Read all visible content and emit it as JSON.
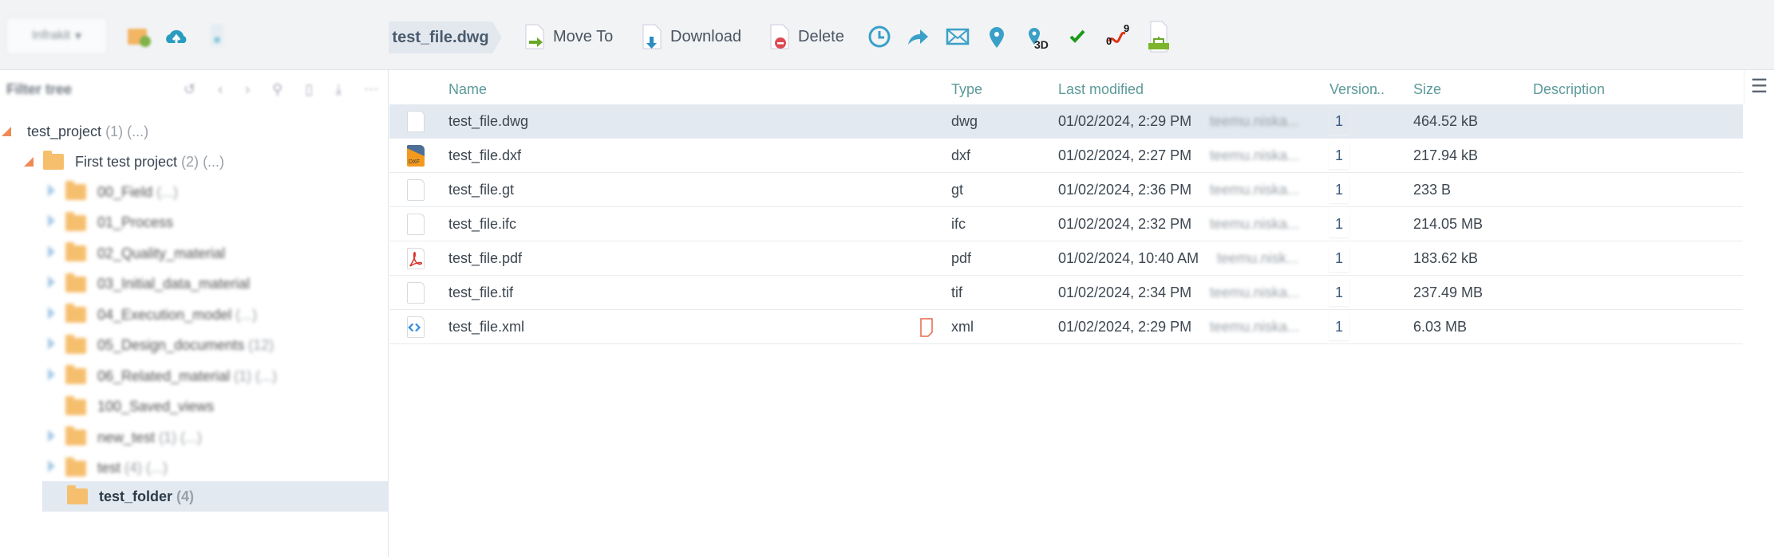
{
  "topbar": {
    "org": "Infrakit",
    "breadcrumb": "test_file.dwg",
    "move_to": "Move To",
    "download": "Download",
    "delete": "Delete",
    "badge_3d": "3D",
    "seq_from": "0",
    "seq_to": "9"
  },
  "sidebar": {
    "filter": "Filter tree",
    "root": {
      "label": "test_project",
      "count": "(1)",
      "more": "(...)"
    },
    "project": {
      "label": "First test project",
      "count": "(2)",
      "more": "(...)"
    },
    "folders": [
      {
        "label": "00_Field",
        "count": "(...)"
      },
      {
        "label": "01_Process",
        "count": ""
      },
      {
        "label": "02_Quality_material",
        "count": ""
      },
      {
        "label": "03_Initial_data_material",
        "count": ""
      },
      {
        "label": "04_Execution_model",
        "count": "(...)"
      },
      {
        "label": "05_Design_documents",
        "count": "(12)"
      },
      {
        "label": "06_Related_material",
        "count": "(1) (...)"
      },
      {
        "label": "100_Saved_views",
        "count": ""
      },
      {
        "label": "new_test",
        "count": "(1) (...)"
      },
      {
        "label": "test",
        "count": "(4) (...)"
      }
    ],
    "selected": {
      "label": "test_folder",
      "count": "(4)"
    }
  },
  "table": {
    "headers": {
      "name": "Name",
      "type": "Type",
      "modified": "Last modified",
      "version": "Version",
      "more": "...",
      "size": "Size",
      "description": "Description"
    },
    "rows": [
      {
        "name": "test_file.dwg",
        "type": "dwg",
        "modified": "01/02/2024, 2:29 PM",
        "user": "teemu.niska...",
        "version": "1",
        "size": "464.52 kB"
      },
      {
        "name": "test_file.dxf",
        "type": "dxf",
        "modified": "01/02/2024, 2:27 PM",
        "user": "teemu.niska...",
        "version": "1",
        "size": "217.94 kB"
      },
      {
        "name": "test_file.gt",
        "type": "gt",
        "modified": "01/02/2024, 2:36 PM",
        "user": "teemu.niska...",
        "version": "1",
        "size": "233 B"
      },
      {
        "name": "test_file.ifc",
        "type": "ifc",
        "modified": "01/02/2024, 2:32 PM",
        "user": "teemu.niska...",
        "version": "1",
        "size": "214.05 MB"
      },
      {
        "name": "test_file.pdf",
        "type": "pdf",
        "modified": "01/02/2024, 10:40 AM",
        "user": "teemu.nisk...",
        "version": "1",
        "size": "183.62 kB"
      },
      {
        "name": "test_file.tif",
        "type": "tif",
        "modified": "01/02/2024, 2:34 PM",
        "user": "teemu.niska...",
        "version": "1",
        "size": "237.49 MB"
      },
      {
        "name": "test_file.xml",
        "type": "xml",
        "modified": "01/02/2024, 2:29 PM",
        "user": "teemu.niska...",
        "version": "1",
        "size": "6.03 MB"
      }
    ]
  }
}
